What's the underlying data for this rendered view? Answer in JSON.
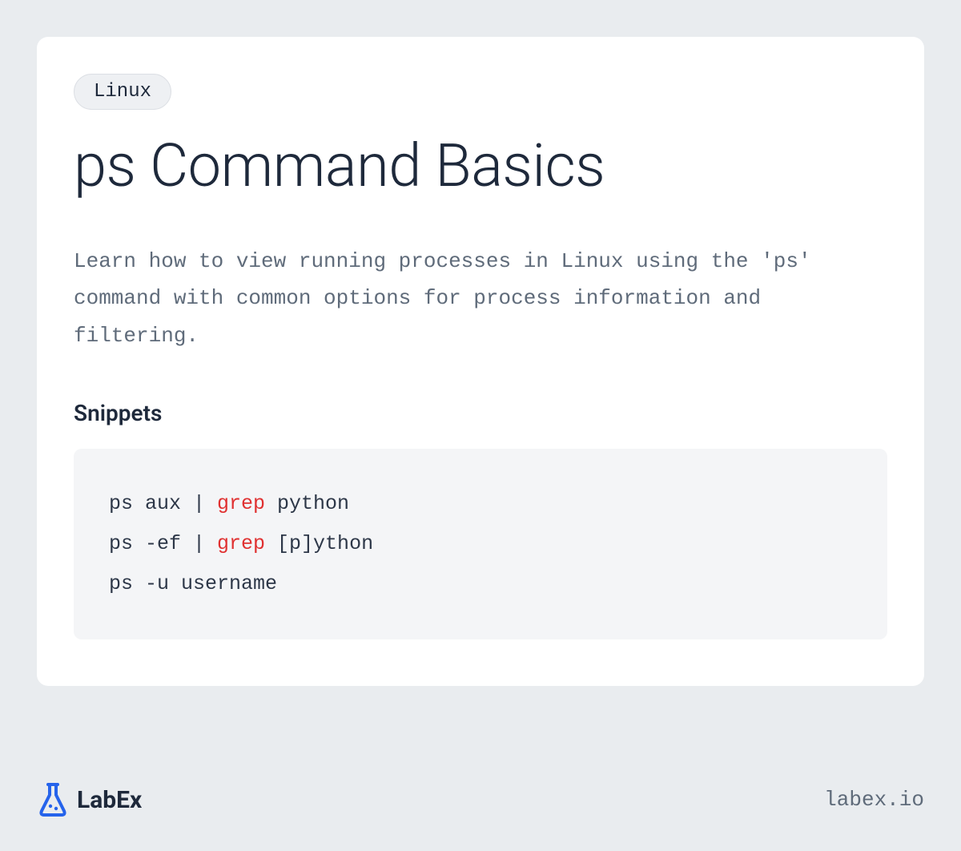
{
  "tag": "Linux",
  "title": "ps Command Basics",
  "description": "Learn how to view running processes in Linux using the 'ps' command with common options for process information and filtering.",
  "snippets_heading": "Snippets",
  "code": {
    "lines": [
      {
        "prefix": "ps aux | ",
        "highlight": "grep",
        "suffix": " python"
      },
      {
        "prefix": "ps -ef | ",
        "highlight": "grep",
        "suffix": " [p]ython"
      },
      {
        "prefix": "ps -u username",
        "highlight": "",
        "suffix": ""
      }
    ]
  },
  "footer": {
    "brand": "LabEx",
    "url": "labex.io"
  }
}
